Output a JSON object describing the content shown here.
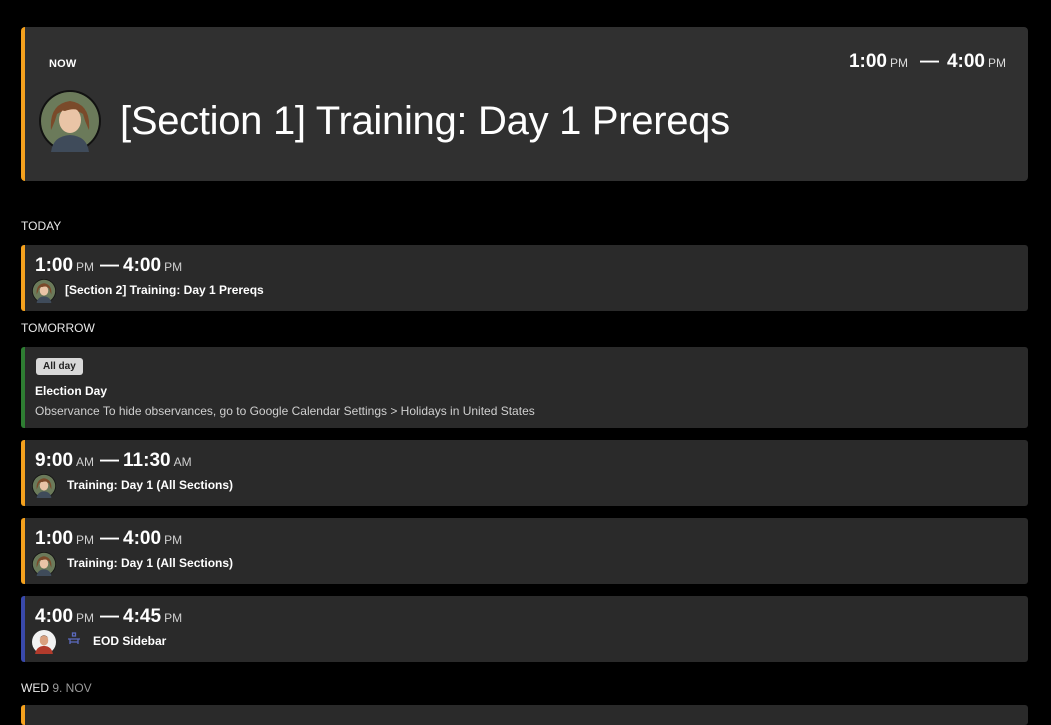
{
  "now_card": {
    "label": "NOW",
    "start": "1:00",
    "start_ampm": "PM",
    "dash": "—",
    "end": "4:00",
    "end_ampm": "PM",
    "title": "[Section 1] Training: Day 1 Prereqs",
    "accent": "#f4a11e"
  },
  "days": [
    {
      "header": "TODAY",
      "header_sub": "",
      "events": [
        {
          "start": "1:00",
          "start_ampm": "PM",
          "dash": "—",
          "end": "4:00",
          "end_ampm": "PM",
          "title": "[Section 2] Training: Day 1 Prereqs",
          "avatar": "woman-avatar",
          "color": "#f4a11e"
        }
      ]
    },
    {
      "header": "TOMORROW",
      "header_sub": "",
      "all_day": {
        "badge": "All day",
        "title": "Election Day",
        "description": "Observance To hide observances, go to Google Calendar Settings > Holidays in United States",
        "color": "#2e7d32"
      },
      "events": [
        {
          "start": "9:00",
          "start_ampm": "AM",
          "dash": "—",
          "end": "11:30",
          "end_ampm": "AM",
          "title": "Training: Day 1 (All Sections)",
          "avatar": "woman-avatar",
          "color": "#f4a11e"
        },
        {
          "start": "1:00",
          "start_ampm": "PM",
          "dash": "—",
          "end": "4:00",
          "end_ampm": "PM",
          "title": "Training: Day 1 (All Sections)",
          "avatar": "woman-avatar",
          "color": "#f4a11e"
        },
        {
          "start": "4:00",
          "start_ampm": "PM",
          "dash": "—",
          "end": "4:45",
          "end_ampm": "PM",
          "title": "EOD Sidebar",
          "avatar": "man-avatar",
          "icon": "meeting-room-icon",
          "color": "#3949ab"
        }
      ]
    },
    {
      "header": "WED",
      "header_sub": "9. NOV",
      "events": []
    }
  ]
}
